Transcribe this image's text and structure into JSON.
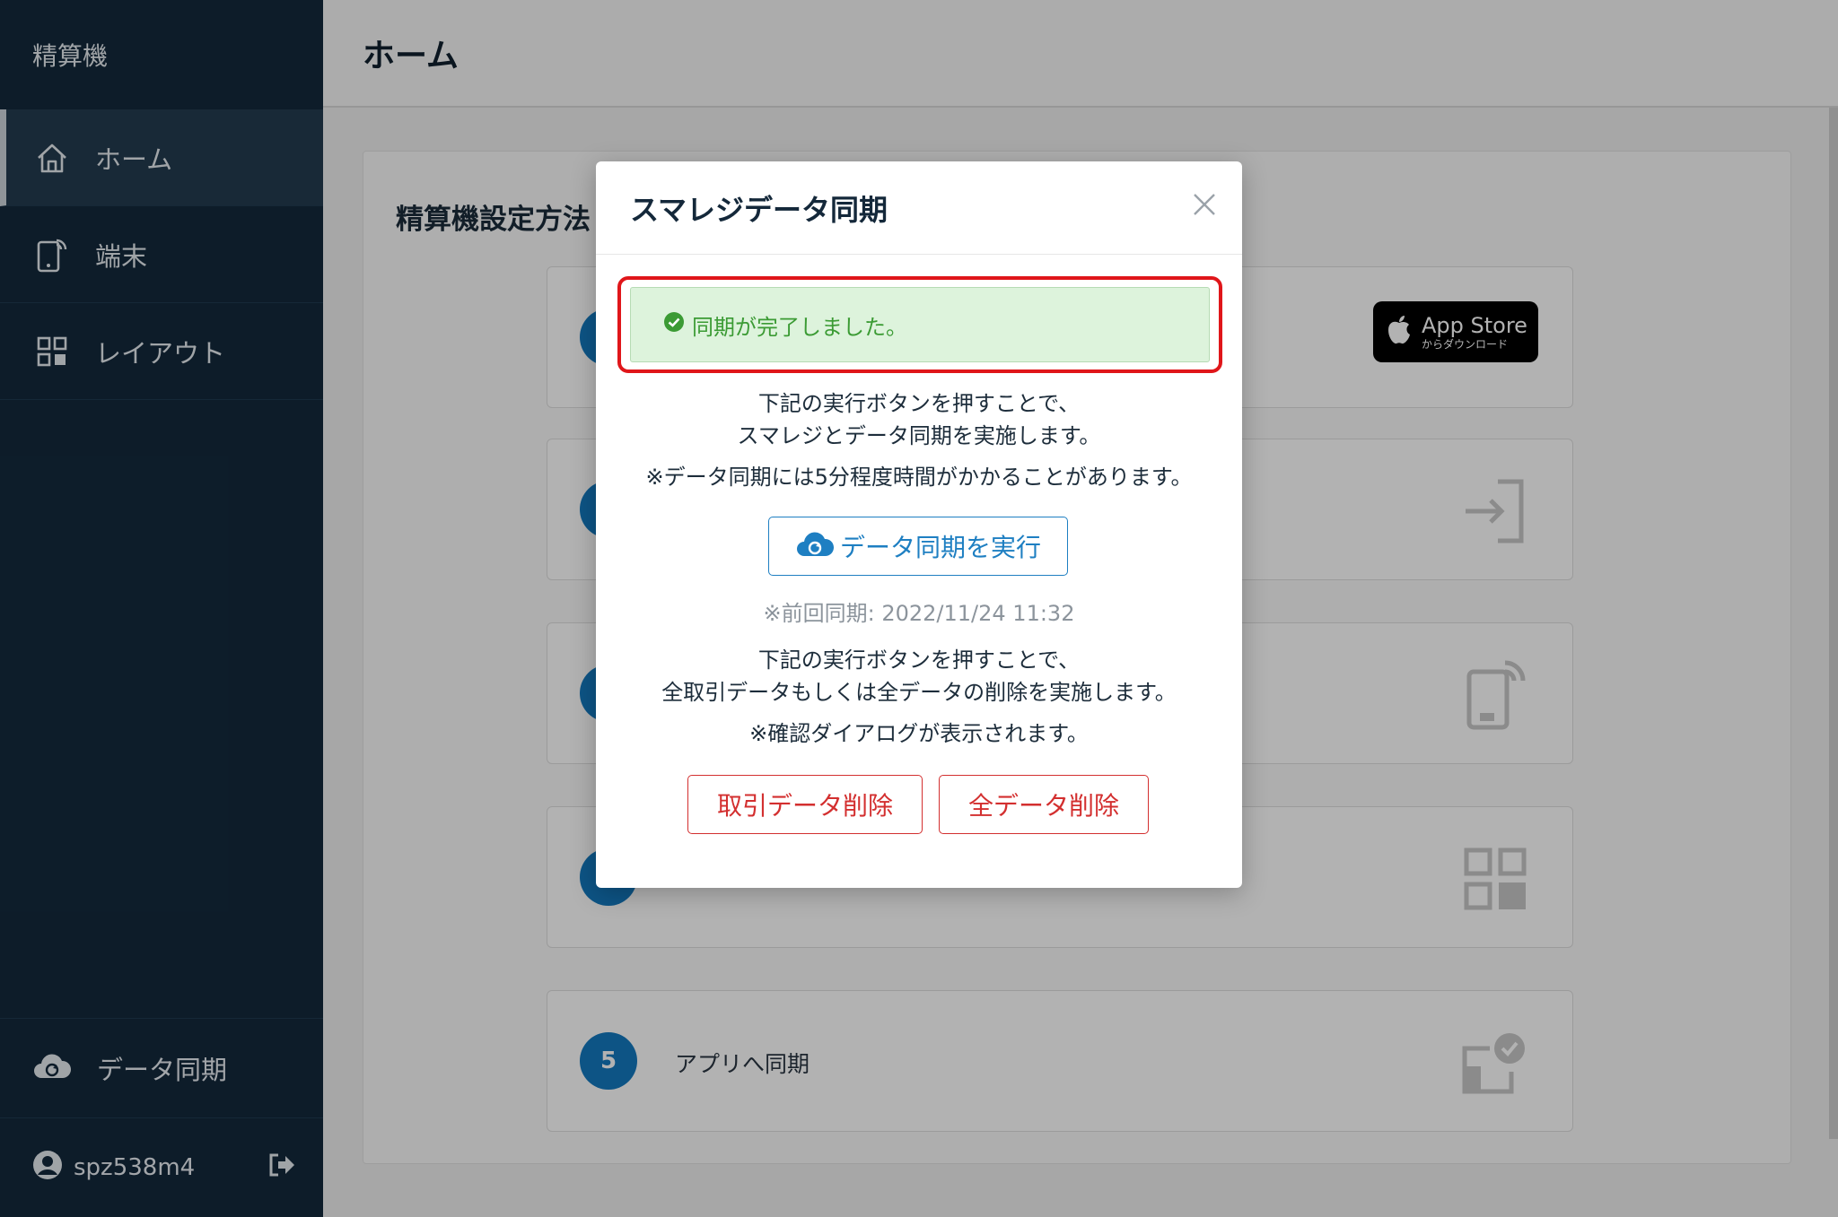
{
  "sidebar": {
    "brand": "精算機",
    "items": [
      {
        "label": "ホーム",
        "icon": "home-icon",
        "active": true
      },
      {
        "label": "端末",
        "icon": "tablet-icon",
        "active": false
      },
      {
        "label": "レイアウト",
        "icon": "layout-grid-icon",
        "active": false
      }
    ],
    "sync": {
      "label": "データ同期",
      "icon": "cloud-sync-icon"
    },
    "user": {
      "name": "spz538m4",
      "icon": "user-icon",
      "logout_icon": "logout-icon"
    }
  },
  "topbar": {
    "title": "ホーム"
  },
  "main": {
    "card_title": "精算機設定方法",
    "appstore": {
      "big": "App Store",
      "small": "からダウンロード"
    },
    "steps": [
      {
        "num": "",
        "label": ""
      },
      {
        "num": "",
        "label": ""
      },
      {
        "num": "",
        "label": ""
      },
      {
        "num": "",
        "label": ""
      },
      {
        "num": "5",
        "label": "アプリへ同期"
      }
    ]
  },
  "modal": {
    "title": "スマレジデータ同期",
    "alert": "同期が完了しました。",
    "sync_desc_1": "下記の実行ボタンを押すことで、",
    "sync_desc_2": "スマレジとデータ同期を実施します。",
    "sync_note": "※データ同期には5分程度時間がかかることがあります。",
    "run_button": "データ同期を実行",
    "last_sync": "※前回同期: 2022/11/24 11:32",
    "delete_desc_1": "下記の実行ボタンを押すことで、",
    "delete_desc_2": "全取引データもしくは全データの削除を実施します。",
    "delete_note": "※確認ダイアログが表示されます。",
    "delete_tx_button": "取引データ削除",
    "delete_all_button": "全データ削除"
  },
  "colors": {
    "sidebar_bg": "#13293c",
    "accent_blue": "#1479bf",
    "success_green": "#3b9b34",
    "danger_red": "#d32f2f",
    "highlight_red": "#e0161a"
  }
}
